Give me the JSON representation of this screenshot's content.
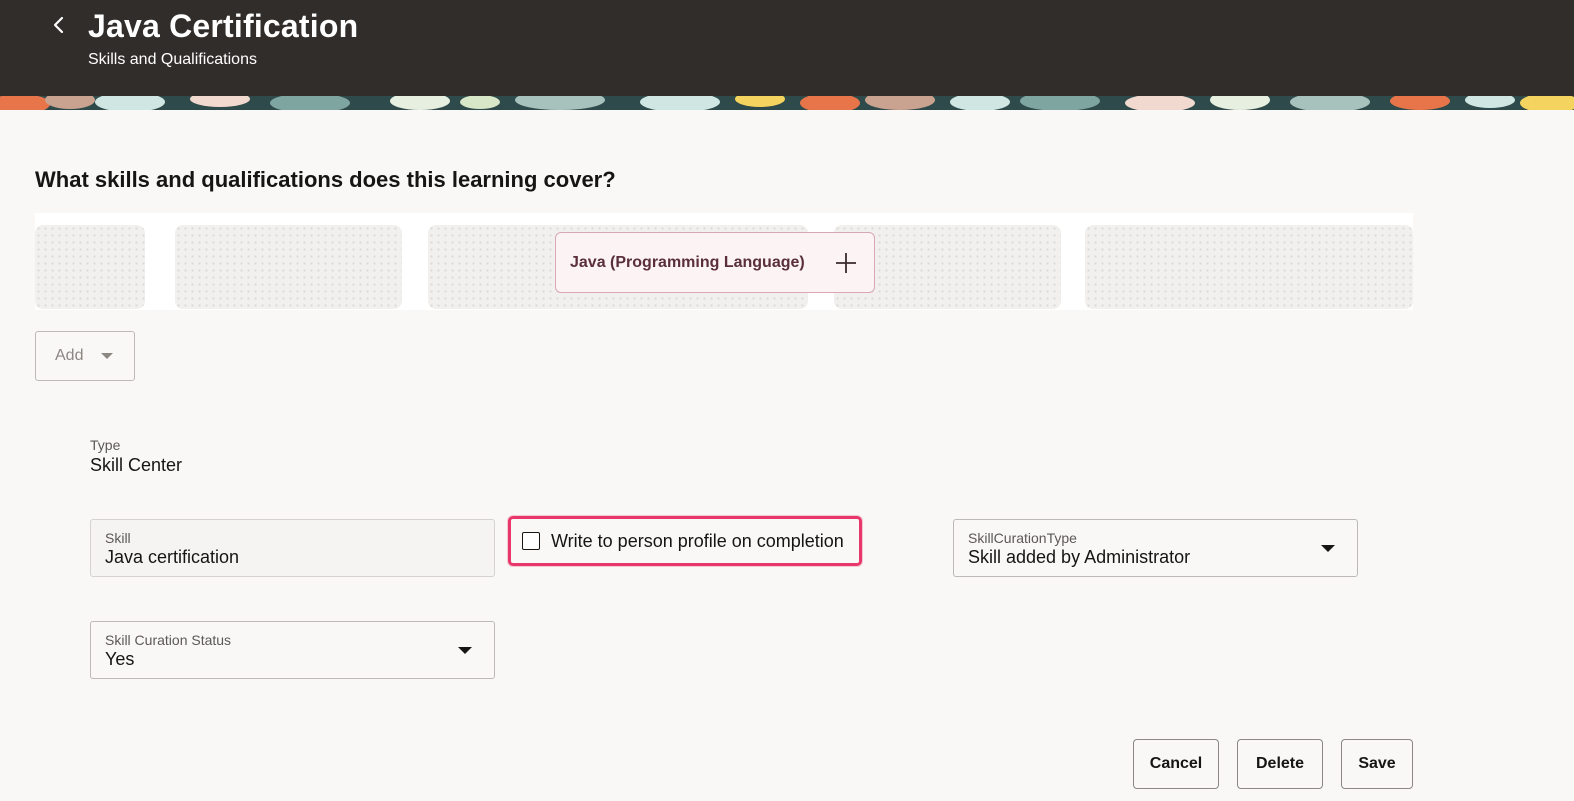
{
  "header": {
    "back_icon": "chevron-left-icon",
    "title": "Java Certification",
    "subtitle": "Skills and Qualifications",
    "background": "#312d2a"
  },
  "section": {
    "question": "What skills and qualifications does this learning cover?"
  },
  "suggestions": {
    "chip_label": "Java (Programming Language)",
    "chip_icon": "plus-icon"
  },
  "add_button": {
    "label": "Add",
    "icon": "caret-down-icon"
  },
  "form": {
    "type_label": "Type",
    "type_value": "Skill Center",
    "skill_label": "Skill",
    "skill_value": "Java certification",
    "write_profile_label": "Write to person profile on completion",
    "write_profile_checked": false,
    "curation_type_label": "SkillCurationType",
    "curation_type_value": "Skill added by Administrator",
    "curation_status_label": "Skill Curation Status",
    "curation_status_value": "Yes"
  },
  "actions": {
    "cancel": "Cancel",
    "delete": "Delete",
    "save": "Save"
  },
  "colors": {
    "highlight": "#e8376a",
    "chip_background": "#fcf4f4",
    "chip_text": "#5a2f3a"
  }
}
